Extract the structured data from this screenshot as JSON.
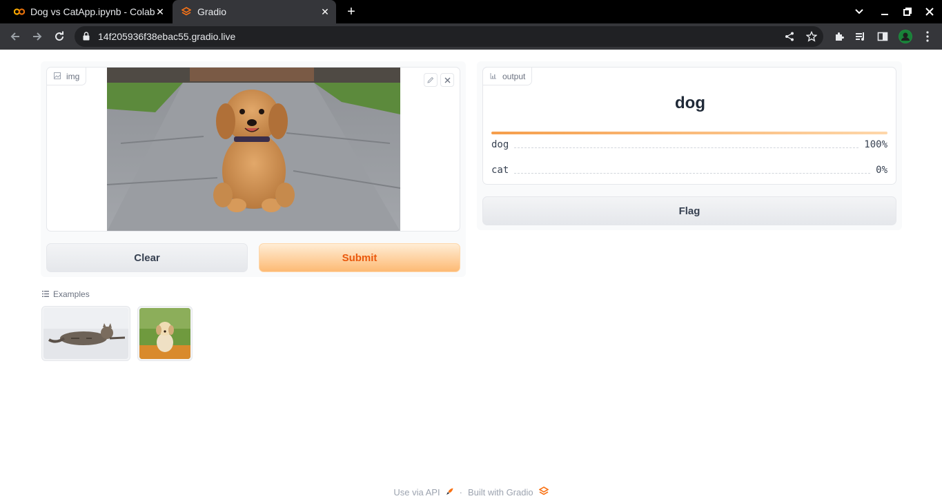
{
  "browser": {
    "tabs": [
      {
        "title": "Dog vs CatApp.ipynb - Colaboratory",
        "icon": "colab-icon",
        "active": false
      },
      {
        "title": "Gradio",
        "icon": "gradio-icon",
        "active": true
      }
    ],
    "url": "14f205936f38ebac55.gradio.live"
  },
  "input": {
    "label": "img",
    "clear_label": "Clear",
    "submit_label": "Submit"
  },
  "output": {
    "label": "output",
    "predicted": "dog",
    "confidences": [
      {
        "label": "dog",
        "value": "100%",
        "fraction": 1.0
      },
      {
        "label": "cat",
        "value": "0%",
        "fraction": 0.0
      }
    ],
    "flag_label": "Flag"
  },
  "examples": {
    "label": "Examples",
    "items": [
      {
        "name": "cat-example",
        "icon": "cat-photo"
      },
      {
        "name": "dog-example",
        "icon": "dog-photo"
      }
    ]
  },
  "footer": {
    "api_label": "Use via API",
    "separator": "·",
    "built_label": "Built with Gradio"
  },
  "colors": {
    "accent": "#ea580c",
    "primary_gradient_start": "#ffedd5",
    "primary_gradient_end": "#fdba74"
  }
}
